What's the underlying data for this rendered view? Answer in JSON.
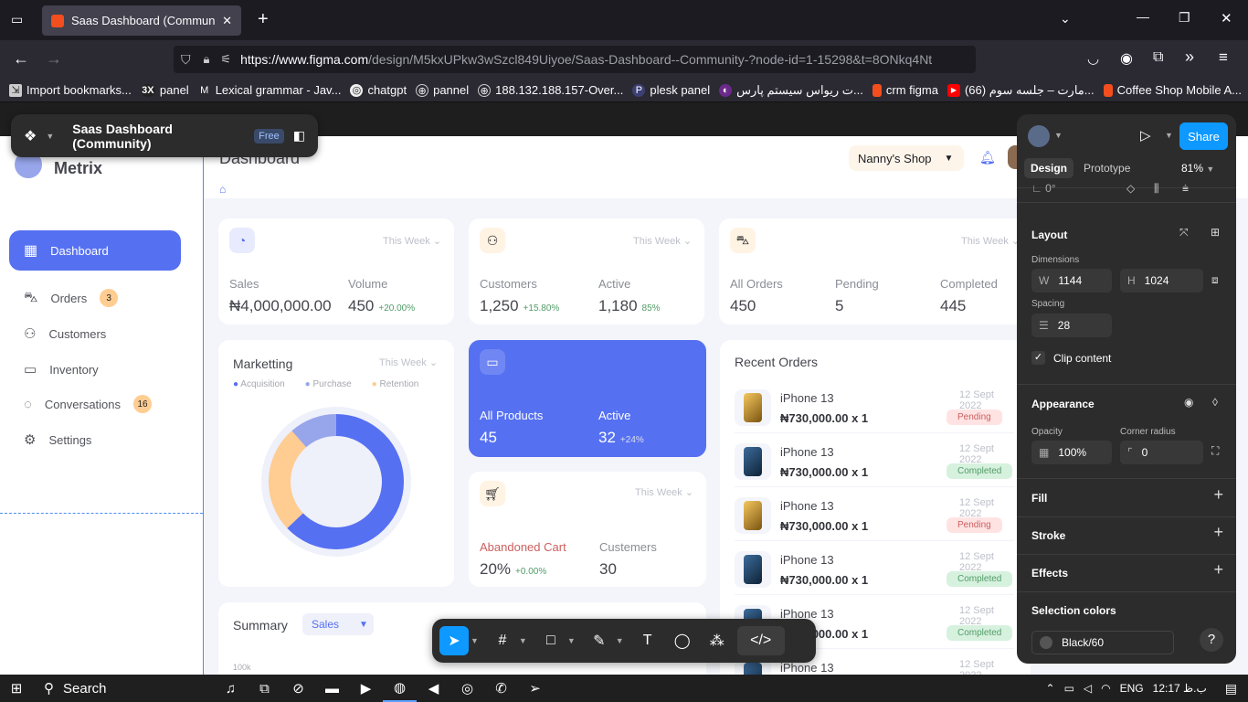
{
  "browser": {
    "tab_title": "Saas Dashboard (Community) –",
    "url_host": "https://www.figma.com",
    "url_path": "/design/M5kxUPkw3wSzcl849Uiyoe/Saas-Dashboard--Community-?node-id=1-15298&t=8ONkq4Nt",
    "bookmarks": [
      "Import bookmarks...",
      "panel",
      "Lexical grammar - Jav...",
      "chatgpt",
      "pannel",
      "188.132.188.157-Over...",
      "plesk panel",
      "ت ریواس سیستم پارس...",
      "crm figma",
      "مارت – جلسه سوم (66)...",
      "Coffee Shop Mobile A..."
    ]
  },
  "figma": {
    "file_name": "Saas Dashboard (Community)",
    "plan_badge": "Free",
    "share_label": "Share",
    "tabs": [
      "Design",
      "Prototype"
    ],
    "zoom": "81%",
    "top_value": "0°",
    "layout": {
      "title": "Layout",
      "dimensions_label": "Dimensions",
      "w_label": "W",
      "w_value": "1144",
      "h_label": "H",
      "h_value": "1024",
      "spacing_label": "Spacing",
      "spacing_value": "28",
      "clip_label": "Clip content"
    },
    "appearance": {
      "title": "Appearance",
      "opacity_label": "Opacity",
      "opacity_value": "100%",
      "radius_label": "Corner radius",
      "radius_value": "0"
    },
    "fill": "Fill",
    "stroke": "Stroke",
    "effects": "Effects",
    "selection_colors": "Selection colors",
    "selection_color_name": "Black/60",
    "help": "?"
  },
  "app": {
    "logo": "Metrix",
    "page_title": "Dashboard",
    "shop": "Nanny's Shop",
    "nav": [
      {
        "label": "Dashboard",
        "badge": ""
      },
      {
        "label": "Orders",
        "badge": "3"
      },
      {
        "label": "Customers",
        "badge": ""
      },
      {
        "label": "Inventory",
        "badge": ""
      },
      {
        "label": "Conversations",
        "badge": "16"
      },
      {
        "label": "Settings",
        "badge": ""
      }
    ],
    "this_week": "This Week",
    "sales": {
      "l1": "Sales",
      "v1": "₦4,000,000.00",
      "l2": "Volume",
      "v2": "450",
      "p2": "+20.00%"
    },
    "customers": {
      "l1": "Customers",
      "v1": "1,250",
      "p1": "+15.80%",
      "l2": "Active",
      "v2": "1,180",
      "p2": "85%"
    },
    "orders": {
      "l1": "All Orders",
      "v1": "450",
      "l2": "Pending",
      "v2": "5",
      "l3": "Completed",
      "v3": "445"
    },
    "marketing": {
      "title": "Marketting",
      "legend": [
        "Acquisition",
        "Purchase",
        "Retention"
      ]
    },
    "products": {
      "l1": "All Products",
      "v1": "45",
      "l2": "Active",
      "v2": "32",
      "p2": "+24%"
    },
    "cart": {
      "l1": "Abandoned Cart",
      "v1": "20%",
      "p1": "+0.00%",
      "l2": "Custemers",
      "v2": "30"
    },
    "recent": {
      "title": "Recent Orders",
      "items": [
        {
          "name": "iPhone 13",
          "price": "₦730,000.00 x 1",
          "date": "12 Sept 2022",
          "status": "Pending",
          "color": "gold"
        },
        {
          "name": "iPhone 13",
          "price": "₦730,000.00 x 1",
          "date": "12 Sept 2022",
          "status": "Completed",
          "color": "blue"
        },
        {
          "name": "iPhone 13",
          "price": "₦730,000.00 x 1",
          "date": "12 Sept 2022",
          "status": "Pending",
          "color": "gold"
        },
        {
          "name": "iPhone 13",
          "price": "₦730,000.00 x 1",
          "date": "12 Sept 2022",
          "status": "Completed",
          "color": "blue"
        },
        {
          "name": "iPhone 13",
          "price": "₦730,000.00 x 1",
          "date": "12 Sept 2022",
          "status": "Completed",
          "color": "blue"
        },
        {
          "name": "iPhone 13",
          "price": "",
          "date": "12 Sept 2022",
          "status": "",
          "color": "blue"
        }
      ]
    },
    "summary": {
      "title": "Summary",
      "select": "Sales",
      "axis_top": "100k"
    }
  },
  "taskbar": {
    "search": "Search",
    "lang": "ENG",
    "time": "12:17 ب.ظ"
  },
  "colors": {
    "primary": "#5570f1",
    "secondary": "#97a5eb",
    "tertiary": "#ffcc91",
    "figma_blue": "#0d99ff"
  }
}
